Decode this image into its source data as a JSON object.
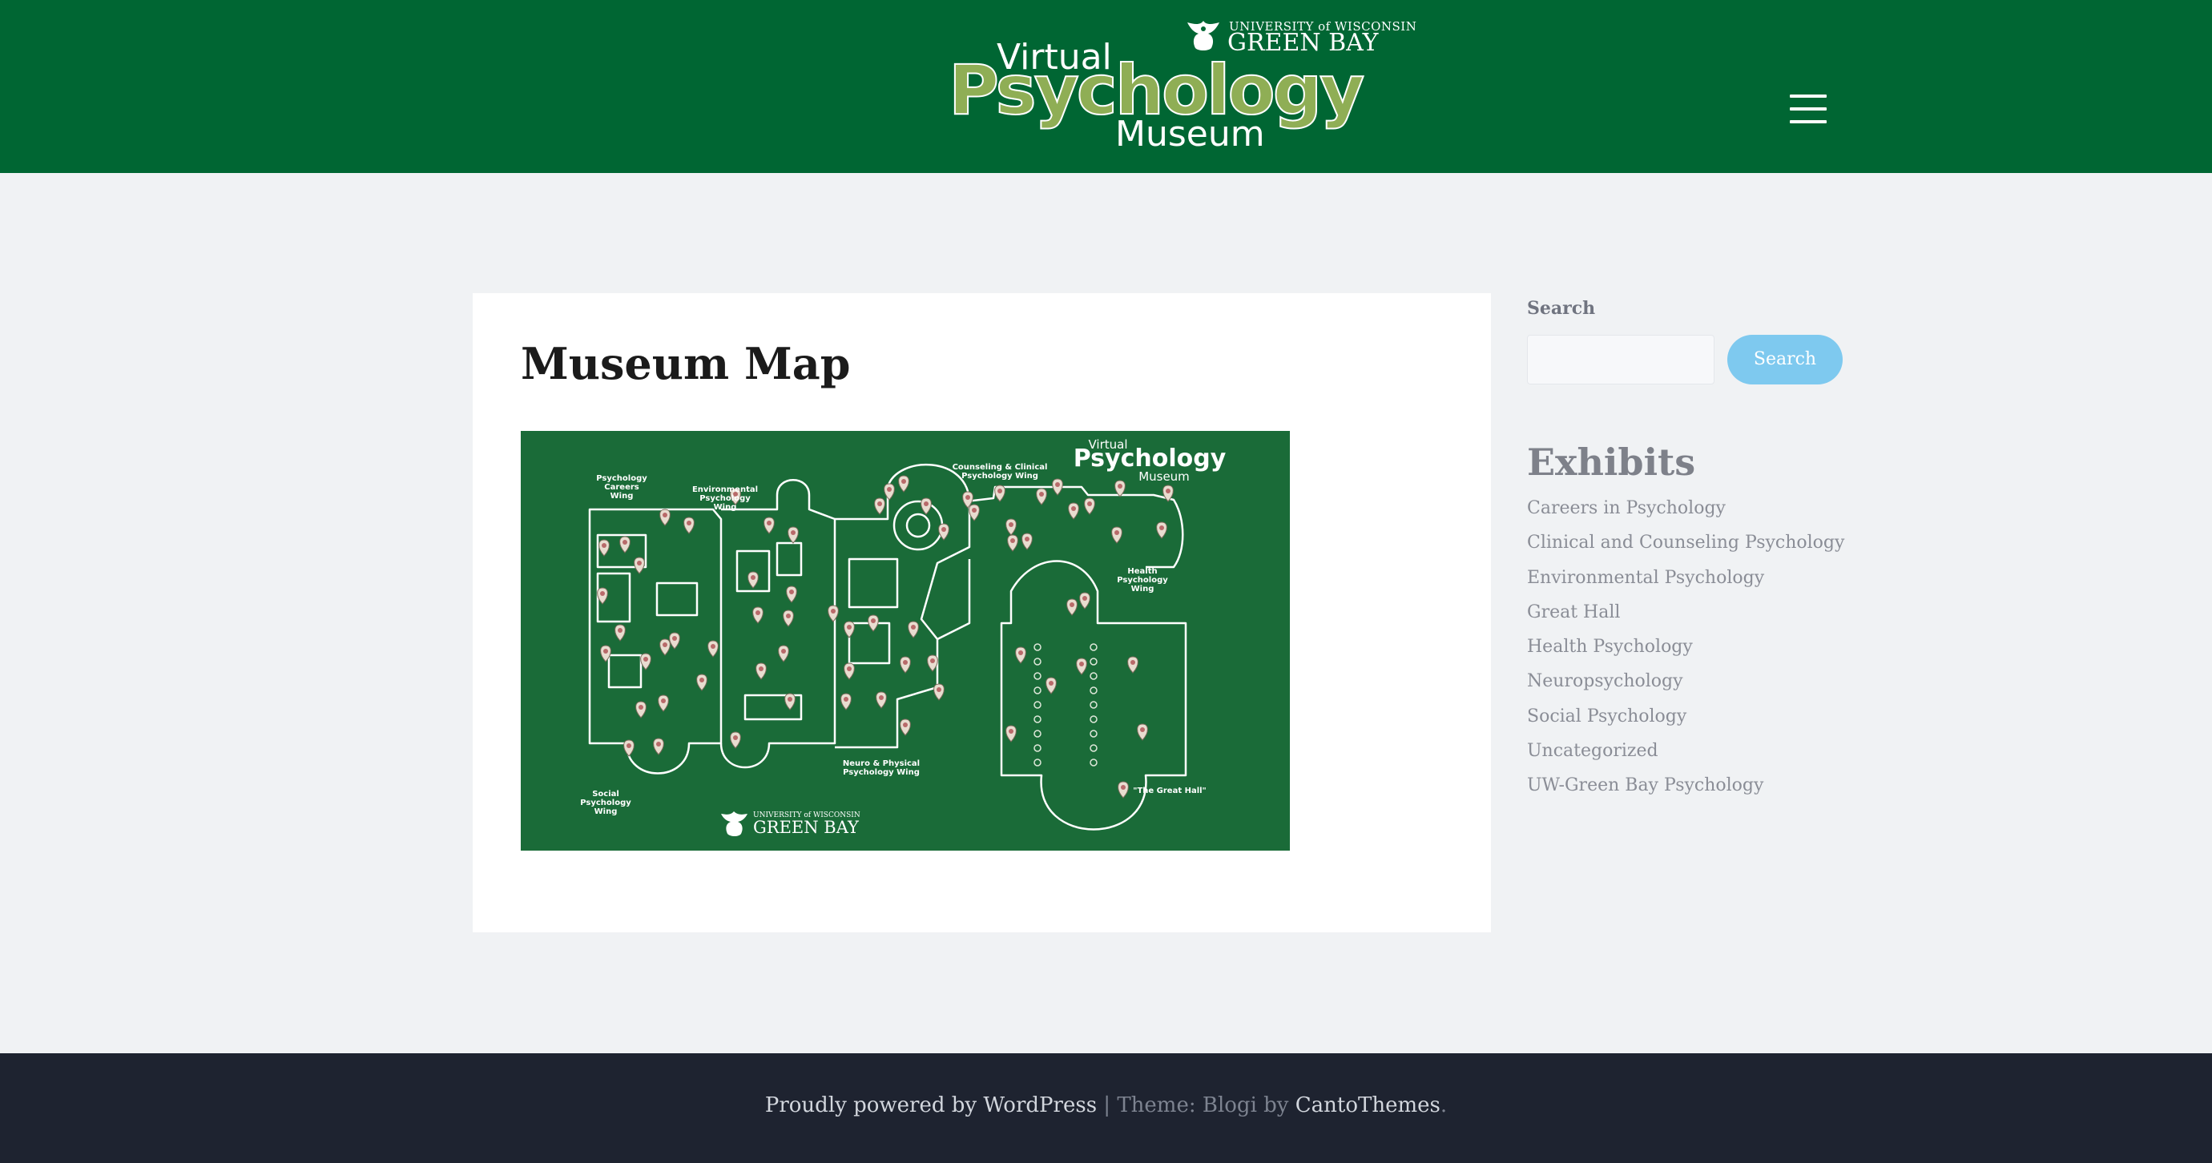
{
  "header": {
    "logo": {
      "university_small": "UNIVERSITY of WISCONSIN",
      "university_big": "GREEN BAY",
      "line1": "Virtual",
      "line2": "Psychology",
      "line3": "Museum"
    },
    "menu_icon": "hamburger-menu-icon"
  },
  "main": {
    "title": "Museum Map",
    "map_image": {
      "labels": {
        "careers": [
          "Psychology",
          "Careers",
          "Wing"
        ],
        "environmental": [
          "Environmental",
          "Psychology",
          "Wing"
        ],
        "counseling": [
          "Counseling & Clinical",
          "Psychology Wing"
        ],
        "health": [
          "Health",
          "Psychology",
          "Wing"
        ],
        "social": [
          "Social",
          "Psychology",
          "Wing"
        ],
        "neuro": [
          "Neuro & Physical",
          "Psychology Wing"
        ],
        "great_hall": "\"The Great Hall\"",
        "brand_virtual": "Virtual",
        "brand_psychology": "Psychology",
        "brand_museum": "Museum",
        "uw_small": "UNIVERSITY of WISCONSIN",
        "uw_big": "GREEN BAY"
      }
    }
  },
  "sidebar": {
    "search_label": "Search",
    "search_placeholder": "",
    "search_button": "Search",
    "exhibits_title": "Exhibits",
    "categories": [
      "Careers in Psychology",
      "Clinical and Counseling Psychology",
      "Environmental Psychology",
      "Great Hall",
      "Health Psychology",
      "Neuropsychology",
      "Social Psychology",
      "Uncategorized",
      "UW-Green Bay Psychology"
    ]
  },
  "footer": {
    "powered": "Proudly powered by WordPress",
    "separator": " | Theme: Blogi by ",
    "theme_author": "CantoThemes",
    "period": "."
  },
  "colors": {
    "header_bg": "#006633",
    "logo_green": "#8fae55",
    "map_bg": "#1a6b38",
    "search_button": "#7ec9ef",
    "footer_bg": "#1e2330"
  }
}
